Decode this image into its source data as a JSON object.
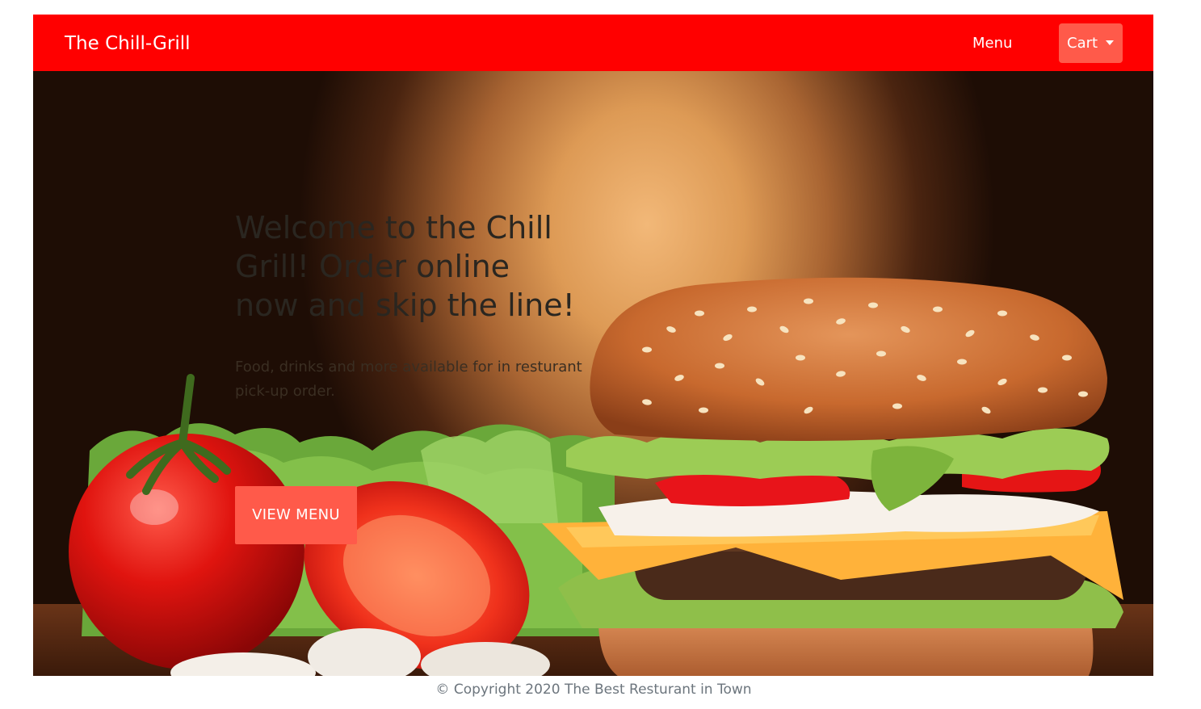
{
  "navbar": {
    "brand": "The Chill-Grill",
    "menu_link": "Menu",
    "cart_label": "Cart",
    "cart_icon": "caret-down-icon",
    "background_color": "#ff0000",
    "cart_button_color": "#ff5a4a"
  },
  "hero": {
    "title": "Welcome to the Chill Grill! Order online now and skip the line!",
    "subtitle": "Food, drinks and more available for in resturant pick-up order.",
    "button_label": "VIEW MENU",
    "button_color": "#ff5a4a",
    "image": "burger-and-tomatoes-photo"
  },
  "footer": {
    "copyright": "© Copyright 2020 The Best Resturant in Town"
  }
}
